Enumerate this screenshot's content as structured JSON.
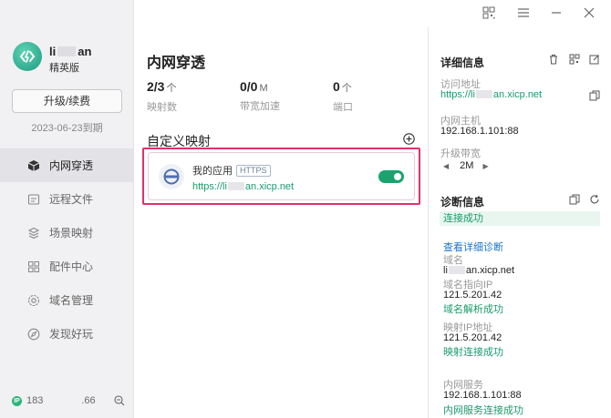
{
  "sidebar": {
    "user_name_a": "li",
    "user_name_b": "an",
    "plan": "精英版",
    "upgrade_label": "升级/续费",
    "expiry": "2023-06-23到期",
    "nav": [
      {
        "label": "内网穿透",
        "icon": "cube-icon"
      },
      {
        "label": "远程文件",
        "icon": "file-icon"
      },
      {
        "label": "场景映射",
        "icon": "scene-icon"
      },
      {
        "label": "配件中心",
        "icon": "grid-icon"
      },
      {
        "label": "域名管理",
        "icon": "gear-icon"
      },
      {
        "label": "发现好玩",
        "icon": "compass-icon"
      }
    ],
    "footer": {
      "ip_badge": "IP",
      "ip_part_a": "183",
      "ip_part_b": ".66"
    }
  },
  "main": {
    "title": "内网穿透",
    "stats": [
      {
        "num": "2/3",
        "unit": "个",
        "label": "映射数"
      },
      {
        "num": "0/0",
        "unit": "M",
        "label": "带宽加速"
      },
      {
        "num": "0",
        "unit": "个",
        "label": "端口"
      }
    ],
    "section_title": "自定义映射",
    "mapping": {
      "name": "我的应用",
      "badge": "HTTPS",
      "url_a": "https://li",
      "url_b": "an.xicp.net",
      "enabled": true
    }
  },
  "detail": {
    "title": "详细信息",
    "access_label": "访问地址",
    "access_url_a": "https://li",
    "access_url_b": "an.xicp.net",
    "host_label": "内网主机",
    "host_value": "192.168.1.101:88",
    "bw_label": "升级带宽",
    "bw_value": "2M"
  },
  "diag": {
    "title": "诊断信息",
    "status": "连接成功",
    "detail_link": "查看详细诊断",
    "domain_label": "域名",
    "domain_a": "li",
    "domain_b": "an.xicp.net",
    "domain_ip_label": "域名指向IP",
    "domain_ip": "121.5.201.42",
    "domain_ok": "域名解析成功",
    "map_ip_label": "映射IP地址",
    "map_ip": "121.5.201.42",
    "map_ok": "映射连接成功",
    "svc_label": "内网服务",
    "svc_value": "192.168.1.101:88",
    "svc_ok": "内网服务连接成功"
  },
  "colors": {
    "accent": "#1aa36e",
    "highlight": "#e0306c",
    "link": "#1a73c9"
  }
}
